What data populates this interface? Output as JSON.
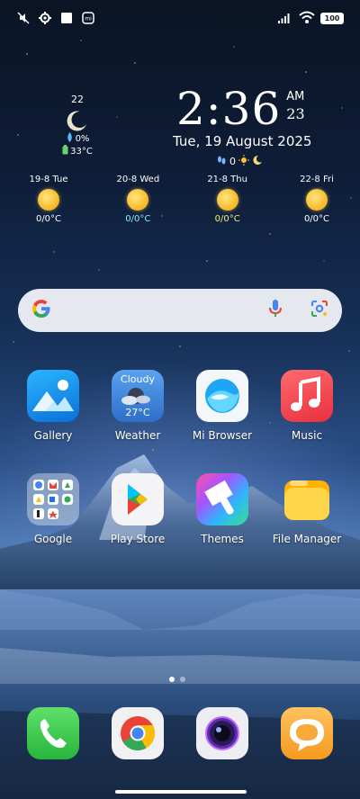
{
  "status_bar": {
    "left_icons": [
      "mute-icon",
      "settings-gear-icon",
      "square-notification-icon",
      "app-notification-icon"
    ],
    "right_icons": [
      "signal-icon",
      "wifi-icon",
      "battery-icon"
    ],
    "battery_level": "100"
  },
  "mini_weather": {
    "temperature": "22",
    "precipitation": "0%",
    "battery_temp": "33°C"
  },
  "clock": {
    "time": "2:36",
    "ampm": "AM",
    "seconds": "23",
    "date": "Tue, 19 August 2025",
    "steps": "0"
  },
  "forecast": [
    {
      "day": "19-8 Tue",
      "temp": "0/0°C",
      "color": "#ffffff"
    },
    {
      "day": "20-8 Wed",
      "temp": "0/0°C",
      "color": "#8fe7ff"
    },
    {
      "day": "21-8 Thu",
      "temp": "0/0°C",
      "color": "#f2f06a"
    },
    {
      "day": "22-8 Fri",
      "temp": "0/0°C",
      "color": "#ffffff"
    }
  ],
  "apps_row1": [
    {
      "label": "Gallery"
    },
    {
      "label": "Weather",
      "condition": "Cloudy",
      "temp": "27°C"
    },
    {
      "label": "Mi Browser"
    },
    {
      "label": "Music"
    }
  ],
  "apps_row2": [
    {
      "label": "Google"
    },
    {
      "label": "Play Store"
    },
    {
      "label": "Themes"
    },
    {
      "label": "File Manager"
    }
  ],
  "dock": [
    "phone",
    "chrome",
    "camera",
    "messages"
  ],
  "pages": {
    "count": 2,
    "active": 1
  }
}
